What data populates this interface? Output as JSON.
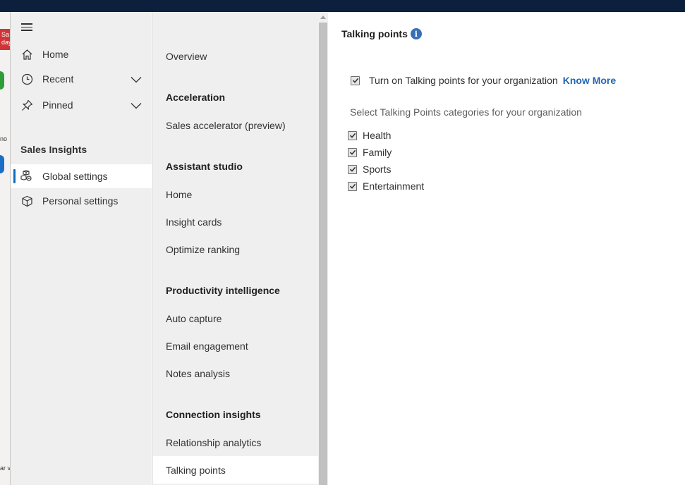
{
  "background_app": {
    "badge_text": "Sa\nday",
    "snippets": [
      "no",
      "ar v"
    ]
  },
  "sitemap": {
    "items": [
      {
        "label": "Home",
        "icon": "home-icon"
      },
      {
        "label": "Recent",
        "icon": "clock-icon"
      },
      {
        "label": "Pinned",
        "icon": "pin-icon"
      }
    ],
    "section_title": "Sales Insights",
    "section_items": [
      {
        "label": "Global settings",
        "icon": "settings-cubes-icon",
        "selected": true
      },
      {
        "label": "Personal settings",
        "icon": "cube-icon",
        "selected": false
      }
    ]
  },
  "settings_menu": {
    "overview": "Overview",
    "groups": [
      {
        "header": "Acceleration",
        "items": [
          "Sales accelerator (preview)"
        ]
      },
      {
        "header": "Assistant studio",
        "items": [
          "Home",
          "Insight cards",
          "Optimize ranking"
        ]
      },
      {
        "header": "Productivity intelligence",
        "items": [
          "Auto capture",
          "Email engagement",
          "Notes analysis"
        ]
      },
      {
        "header": "Connection insights",
        "items": [
          "Relationship analytics",
          "Talking points"
        ]
      }
    ],
    "selected": "Talking points"
  },
  "content": {
    "title": "Talking points",
    "enable_label": "Turn on Talking points for your organization",
    "enable_checked": true,
    "know_more": "Know More",
    "categories_label": "Select Talking Points categories for your organization",
    "categories": [
      {
        "label": "Health",
        "checked": true
      },
      {
        "label": "Family",
        "checked": true
      },
      {
        "label": "Sports",
        "checked": true
      },
      {
        "label": "Entertainment",
        "checked": true
      }
    ]
  },
  "colors": {
    "topbar": "#0c1f3d",
    "accent": "#0f6cbd",
    "link": "#2266b3",
    "nav_bg": "#efefef"
  }
}
